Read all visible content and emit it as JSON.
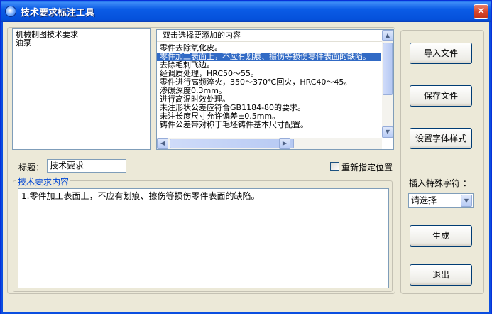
{
  "window": {
    "title": "技术要求标注工具",
    "close_glyph": "✕"
  },
  "category_list": {
    "items": [
      "机械制图技术要求",
      "油泵"
    ]
  },
  "content_list": {
    "header": "双击选择要添加的内容",
    "items": [
      "零件去除氧化皮。",
      "零件加工表面上，不应有划痕、擦伤等损伤零件表面的缺陷。",
      "去除毛刺飞边。",
      "经调质处理，HRC50～55。",
      "零件进行高频淬火，350～370℃回火，HRC40～45。",
      "渗碳深度0.3mm。",
      "进行高温时效处理。",
      "未注形状公差应符合GB1184-80的要求。",
      "未注长度尺寸允许偏差±0.5mm。",
      "铸件公差带对称于毛坯铸件基本尺寸配置。"
    ],
    "selected_index": 1
  },
  "title_field": {
    "label": "标题：",
    "value": "技术要求"
  },
  "reposition_checkbox": {
    "label": "重新指定位置",
    "checked": false
  },
  "content_group": {
    "legend": "技术要求内容",
    "text": "1.零件加工表面上，不应有划痕、擦伤等损伤零件表面的缺陷。"
  },
  "buttons": {
    "import": "导入文件",
    "save": "保存文件",
    "font_style": "设置字体样式",
    "generate": "生成",
    "exit": "退出"
  },
  "special_char": {
    "label": "插入特殊字符 ：",
    "selected": "请选择"
  },
  "icons": {
    "scroll_up": "▲",
    "scroll_down": "▼",
    "scroll_left": "◀",
    "scroll_right": "▶",
    "dropdown": "▼"
  }
}
